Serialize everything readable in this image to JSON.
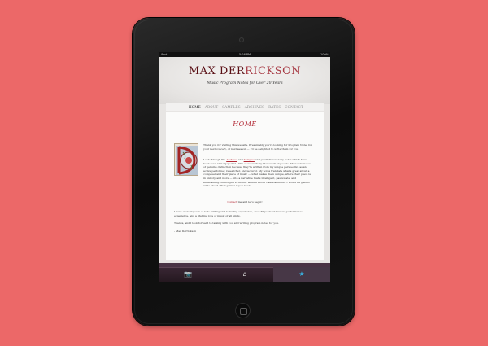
{
  "statusbar": {
    "carrier": "iPad",
    "time": "5:26 PM",
    "battery": "100%"
  },
  "site": {
    "title_part1": "MAX ",
    "title_part2": "DER",
    "title_part3": "RICKSON",
    "subtitle_prefix": "Music Program Notes for ",
    "subtitle_suffix": "Over 20 Years"
  },
  "nav": {
    "items": [
      "HOME",
      "ABOUT",
      "SAMPLES",
      "ARCHIVES",
      "RATES",
      "CONTACT"
    ],
    "active": "HOME"
  },
  "page": {
    "heading": "HOME",
    "p1": "Thank you for visiting this website. Presumably you're looking for Program Notes for your next concert, or next season — I'd be delighted to write them for you.",
    "p2_before": "Look through the ",
    "p2_link1": "Archives",
    "p2_mid": " and ",
    "p2_link2": "Samples",
    "p2_after": " and you'll discover my notes which have been read and enjoyed at 100's of concerts by thousands of people. These are notes of genuine distinction because they're written from my unique perspective as an active performer, researcher, and lecturer. My notes translate what's great about a composer and their piece of music — what makes them unique, where their place is in history, and more — into a narrative that's intelligent, passionate, and entertaining. Although I've mostly written about classical music, I would be glad to write about other genres if you need.",
    "contact_link": "Contact",
    "contact_after": " me and let's begin!",
    "p4": "I have over 20 years of note writing and lecturing experience, over 30 years of musical performance experience, and a lifetime love of music of all kinds.",
    "p5": "Thanks, and I look forward to talking with you and writing program notes for you.",
    "signature": "- Max Derrickson"
  },
  "tabbar": {
    "tabs": [
      {
        "icon": "camera-icon",
        "glyph": "📷"
      },
      {
        "icon": "home-icon",
        "glyph": "⌂"
      },
      {
        "icon": "star-icon",
        "glyph": "★"
      }
    ],
    "active_index": 2
  },
  "colors": {
    "background": "#ec6868",
    "title": "#8a1d28",
    "accent": "#b32a36",
    "tab_active": "#38b8e8"
  }
}
